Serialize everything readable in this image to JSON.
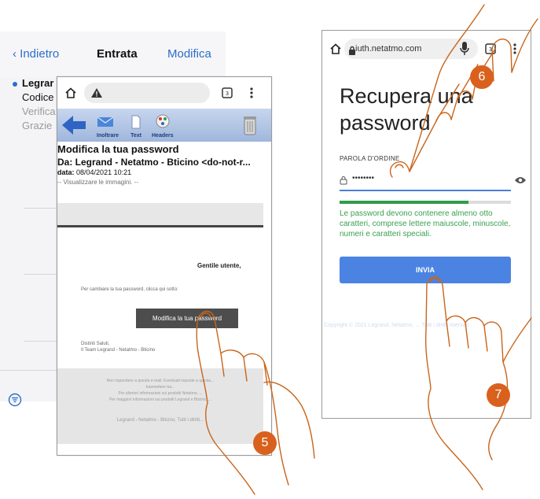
{
  "mail_app": {
    "back_label": "Indietro",
    "title": "Entrata",
    "edit_label": "Modifica",
    "row": {
      "sender": "Legrar",
      "line1": "Codice",
      "line2": "Verifica",
      "line3": "Grazie"
    }
  },
  "email_view": {
    "toolbar": {
      "forward": "Inoltrare",
      "text": "Text",
      "headers": "Headers"
    },
    "subject": "Modifica la tua password",
    "from": "Da: Legrand - Netatmo - Bticino <do-not-r...",
    "date_label": "data:",
    "date_value": "08/04/2021 10:21",
    "view_images": "-- Visualizzare le immagini. --",
    "greeting": "Gentile utente,",
    "instruction": "Per cambiare la tua password, clicca qui sotto:",
    "button_label": "Modifica la tua password",
    "regards": "Distinti Saluti,",
    "team": "Il Team Legrand - Netatmo - Bticino",
    "footer_line1": "Non rispondere a questa e-mail. Eventuali risposte a questa...",
    "footer_line2": "trasmettere tra...",
    "footer_line3": "Per ulteriori informazioni sui prodotti Netatmo, ...",
    "footer_line4": "Per maggiori informazioni sui prodotti Legrand e Bticino, ...",
    "footer_brand": "Legrand - Netatmo - Bticino, Tutti i diritti..."
  },
  "reset_page": {
    "url": "iuth.netatmo.com",
    "title_line1": "Recupera una",
    "title_line2": "password",
    "field_label": "PAROLA D'ORDINE",
    "password_value": "••••••••",
    "strength_fraction": 0.75,
    "note": "Le password devono contenere almeno otto caratteri, comprese lettere maiuscole, minuscole, numeri e caratteri speciali.",
    "submit_label": "INVIA",
    "copyright": "Copyright © 2021 Legrand, Netatmo, ... Tutti i diritti riservati"
  },
  "steps": {
    "step5": "5",
    "step6": "6",
    "step7": "7"
  },
  "colors": {
    "accent_blue": "#2c6ec9",
    "badge_orange": "#d9611d",
    "hand_stroke": "#c8651a",
    "success_green": "#2f9d4a"
  }
}
